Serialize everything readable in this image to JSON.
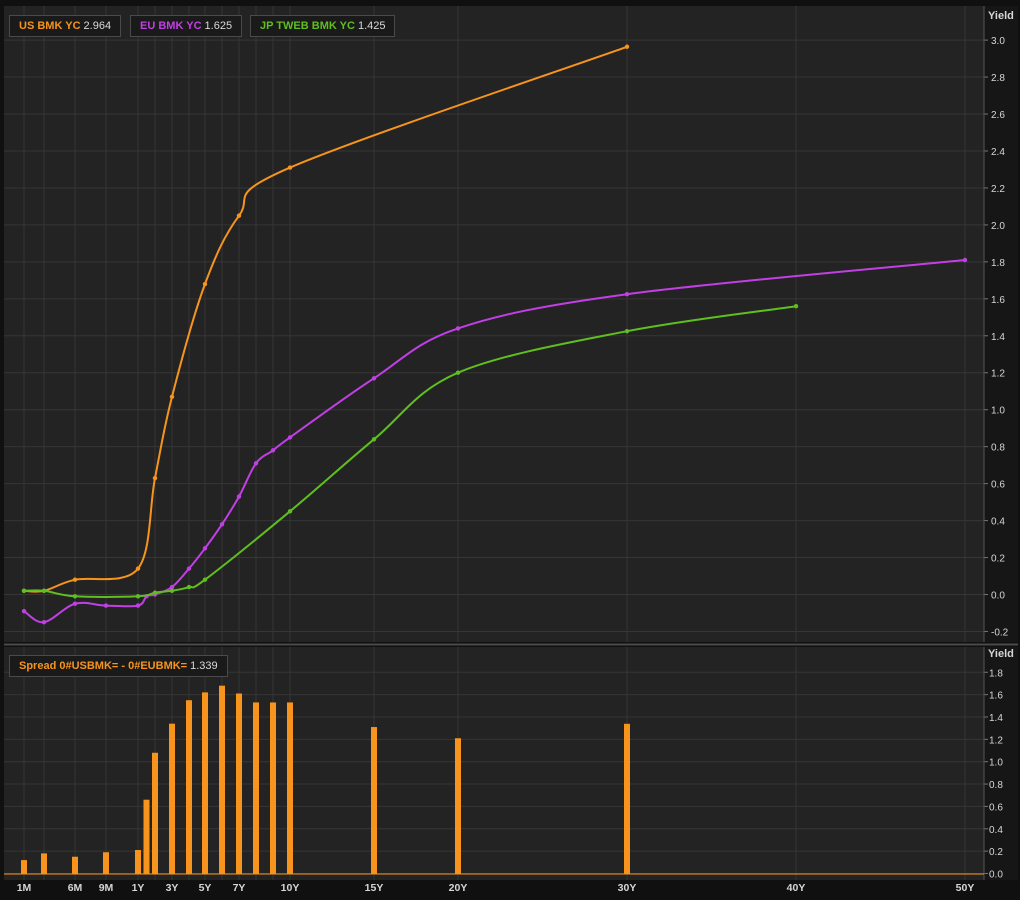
{
  "colors": {
    "background": "#101010",
    "panel": "#232323",
    "grid": "#363636",
    "text": "#d6d6d6",
    "us": "#f7941d",
    "eu": "#c23fe6",
    "jp": "#5fbf1e",
    "spread": "#f7941d"
  },
  "legend": {
    "us": {
      "label": "US BMK YC",
      "value": "2.964"
    },
    "eu": {
      "label": "EU BMK YC",
      "value": "1.625"
    },
    "jp": {
      "label": "JP TWEB BMK YC",
      "value": "1.425"
    },
    "spread": {
      "label": "Spread 0#USBMK= - 0#EUBMK=",
      "value": "1.339"
    }
  },
  "chart_data": [
    {
      "type": "line",
      "ylabel": "Yield",
      "ylim": [
        -0.25,
        3.1
      ],
      "yticks": [
        -0.2,
        0.0,
        0.2,
        0.4,
        0.6,
        0.8,
        1.0,
        1.2,
        1.4,
        1.6,
        1.8,
        2.0,
        2.2,
        2.4,
        2.6,
        2.8,
        3.0
      ],
      "grid": true,
      "legend_position": "top-left",
      "x_unit": "years to maturity",
      "series": [
        {
          "name": "US BMK YC",
          "key": "us",
          "x": [
            0.083,
            0.25,
            0.5,
            1,
            2,
            3,
            5,
            7,
            10,
            30
          ],
          "y": [
            0.02,
            0.02,
            0.08,
            0.14,
            0.63,
            1.07,
            1.68,
            2.05,
            2.31,
            2.964
          ]
        },
        {
          "name": "EU BMK YC",
          "key": "eu",
          "x": [
            0.083,
            0.25,
            0.5,
            0.75,
            1,
            1.5,
            2,
            3,
            4,
            5,
            6,
            7,
            8,
            9,
            10,
            15,
            20,
            30,
            50
          ],
          "y": [
            -0.09,
            -0.15,
            -0.05,
            -0.06,
            -0.06,
            -0.01,
            0.0,
            0.04,
            0.14,
            0.25,
            0.38,
            0.53,
            0.71,
            0.78,
            0.85,
            1.17,
            1.44,
            1.625,
            1.81
          ]
        },
        {
          "name": "JP TWEB BMK YC",
          "key": "jp",
          "x": [
            0.083,
            0.25,
            0.5,
            1,
            2,
            3,
            4,
            5,
            10,
            15,
            20,
            30,
            40
          ],
          "y": [
            0.02,
            0.02,
            -0.01,
            -0.01,
            0.01,
            0.02,
            0.04,
            0.08,
            0.45,
            0.84,
            1.2,
            1.425,
            1.56
          ]
        }
      ]
    },
    {
      "type": "bar",
      "ylabel": "Yield",
      "ylim": [
        0,
        1.85
      ],
      "yticks": [
        0.0,
        0.2,
        0.4,
        0.6,
        0.8,
        1.0,
        1.2,
        1.4,
        1.6,
        1.8
      ],
      "grid": true,
      "legend_position": "top-left",
      "series": [
        {
          "name": "Spread 0#USBMK= - 0#EUBMK=",
          "key": "spread",
          "x": [
            0.083,
            0.25,
            0.5,
            0.75,
            1,
            1.5,
            2,
            3,
            4,
            5,
            6,
            7,
            8,
            9,
            10,
            15,
            20,
            30
          ],
          "y": [
            0.12,
            0.18,
            0.15,
            0.19,
            0.21,
            0.66,
            1.08,
            1.34,
            1.55,
            1.62,
            1.68,
            1.61,
            1.53,
            1.53,
            1.53,
            1.31,
            1.21,
            1.339
          ]
        }
      ]
    }
  ],
  "x_axis": {
    "ticks": [
      {
        "label": "1M",
        "x": 0.083
      },
      {
        "label": "6M",
        "x": 0.5
      },
      {
        "label": "9M",
        "x": 0.75
      },
      {
        "label": "1Y",
        "x": 1
      },
      {
        "label": "3Y",
        "x": 3
      },
      {
        "label": "5Y",
        "x": 5
      },
      {
        "label": "7Y",
        "x": 7
      },
      {
        "label": "10Y",
        "x": 10
      },
      {
        "label": "15Y",
        "x": 15
      },
      {
        "label": "20Y",
        "x": 20
      },
      {
        "label": "30Y",
        "x": 30
      },
      {
        "label": "40Y",
        "x": 40
      },
      {
        "label": "50Y",
        "x": 50
      }
    ]
  }
}
